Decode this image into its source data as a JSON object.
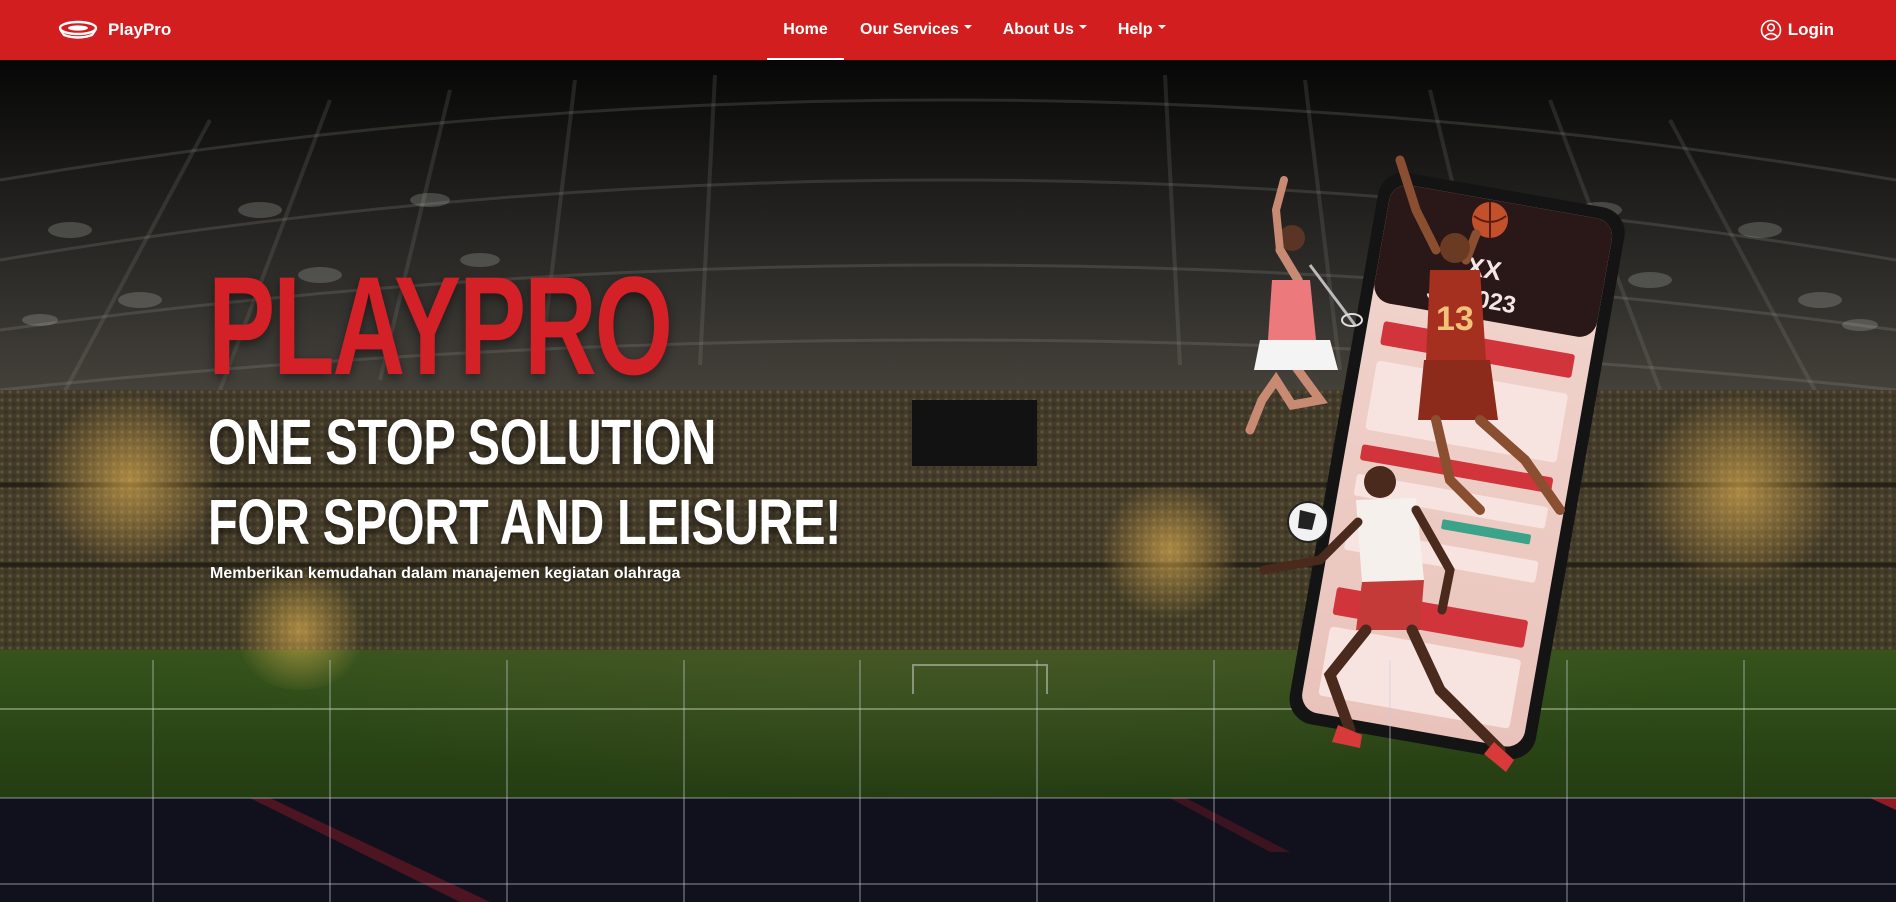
{
  "brand": {
    "name": "PlayPro",
    "icon": "stadium-logo-icon"
  },
  "nav": {
    "items": [
      {
        "label": "Home",
        "active": true,
        "dropdown": false
      },
      {
        "label": "Our Services",
        "active": false,
        "dropdown": true
      },
      {
        "label": "About Us",
        "active": false,
        "dropdown": true
      },
      {
        "label": "Help",
        "active": false,
        "dropdown": true
      }
    ],
    "login": {
      "label": "Login",
      "icon": "user-circle-icon"
    }
  },
  "hero": {
    "title": "PLAYPRO",
    "subtitle_line1": "ONE STOP SOLUTION",
    "subtitle_line2": "FOR SPORT AND LEISURE!",
    "description": "Memberikan kemudahan dalam manajemen kegiatan olahraga",
    "phone_text": {
      "line1": "XX",
      "line2": "JA 2023",
      "jersey_number": "13"
    }
  },
  "colors": {
    "brand_red": "#d21e1e",
    "title_red": "#d42027",
    "dark_band": "#11111d",
    "pitch_green": "#2f4d18"
  }
}
